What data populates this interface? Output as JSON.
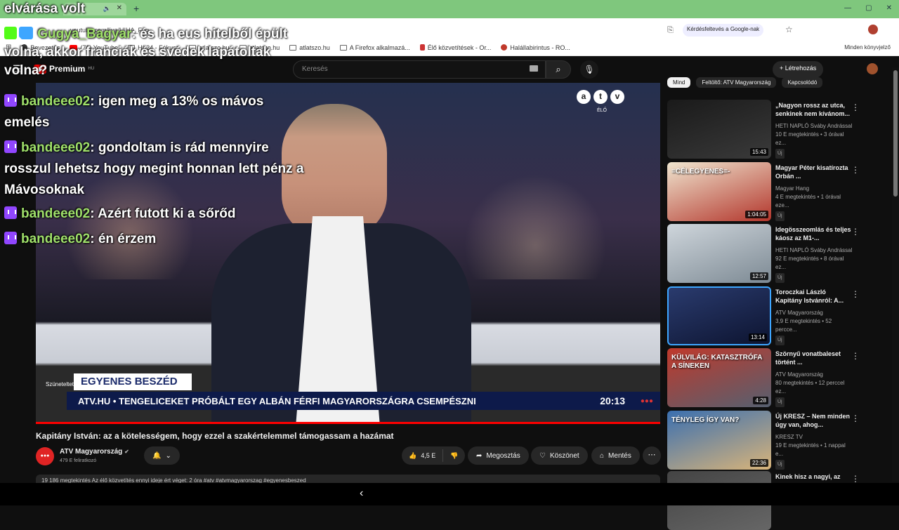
{
  "browser": {
    "tab_title": "elvárása volt",
    "tab_sub": "ss k",
    "url": "youtube.com/live/UIHA_Fgg",
    "search_google": "Kérdésfeltevés a Google-nak",
    "other_bookmarks": "Minden könyvjelző",
    "bookmarks": [
      {
        "label": "Bevezetés",
        "icon": "firefox-icon"
      },
      {
        "label": "(71) YouTube",
        "icon": "youtube-icon"
      },
      {
        "label": "Hír24 - Fókusz",
        "icon": "folder-icon"
      },
      {
        "label": "atlatszo.hu",
        "icon": "folder-icon"
      },
      {
        "label": "atlatszo.hu",
        "icon": "folder-icon"
      },
      {
        "label": "atlatszo.hu",
        "icon": "folder-icon"
      },
      {
        "label": "A Firefox alkalmazá...",
        "icon": "folder-icon"
      },
      {
        "label": "Élő közvetítések - Or...",
        "icon": "live-icon"
      },
      {
        "label": "Halállabirintus - RO...",
        "icon": "game-icon"
      }
    ]
  },
  "youtube": {
    "logo": "Premium",
    "logo_region": "HU",
    "search_placeholder": "Keresés",
    "signin_label": "Létrehozás"
  },
  "chat": {
    "top_line": "elvárása volt",
    "messages": [
      {
        "user": "Gugya_Bagyar",
        "text": ": és ha eus hitelből épült volna, akkor franciák és svédek lapátoltak volna?"
      },
      {
        "user": "bandeee02",
        "text": ": igen meg a 13% os mávos emelés"
      },
      {
        "user": "bandeee02",
        "text": ": gondoltam is rád mennyire rosszul lehetsz hogy megint honnan lett pénz a Mávosoknak"
      },
      {
        "user": "bandeee02",
        "text": ": Azért futott ki a sőrőd"
      },
      {
        "user": "bandeee02",
        "text": ": én érzem"
      }
    ]
  },
  "video": {
    "channel_logo": "atv",
    "live_label": "ÉLŐ",
    "show_name": "EGYENES BESZÉD",
    "site": "ATV.HU",
    "ticker": "• TENGELICEKET PRÓBÁLT EGY ALBÁN FÉRFI MAGYARORSZÁGRA CSEMPÉSZNI",
    "clock": "20:13",
    "small_label": "Szünetelteté... K"
  },
  "info": {
    "title": "Kapitány István: az a kötelességem, hogy ezzel a szakértelemmel támogassam a hazámat",
    "channel": "ATV Magyarország",
    "subs": "479 E feliratkozó",
    "likes": "4,5 E",
    "share": "Megosztás",
    "thanks": "Köszönet",
    "save": "Mentés",
    "desc": "19 186 megtekintés  Az élő közvetítés ennyi ideje ért véget: 2 óra  #atv #atvmagyarorszag #egyenesbeszed"
  },
  "sidebar": {
    "chips": [
      "Mind",
      "Feltöltő: ATV Magyarország",
      "Kapcsolódó"
    ],
    "videos": [
      {
        "title": "„Nagyon rossz az utca, senkinek nem kívánom...",
        "channel": "HETI NAPLÓ Sváby Andrással",
        "meta": "10 E megtekintés • 3 órával ez...",
        "dur": "15:43",
        "badge": "Új",
        "colors": [
          "#1a1a1a",
          "#3a3a3a"
        ]
      },
      {
        "title": "Magyar Péter kisatírozta Orbán ...",
        "channel": "Magyar Hang",
        "meta": "4 E megtekintés • 1 órával eze...",
        "dur": "1:04:05",
        "badge": "Új",
        "colors": [
          "#f0e6d0",
          "#b3362c"
        ]
      },
      {
        "title": "Idegösszeomlás és teljes káosz az M1-...",
        "channel": "HETI NAPLÓ Sváby Andrással",
        "meta": "92 E megtekintés • 8 órával ez...",
        "dur": "12:57",
        "badge": "Új",
        "colors": [
          "#cfd6dc",
          "#7d8a94"
        ]
      },
      {
        "title": "Toroczkai László Kapitány Istvánról: A...",
        "channel": "ATV Magyarország",
        "meta": "3,9 E megtekintés • 52 percce...",
        "dur": "13:14",
        "badge": "Új",
        "colors": [
          "#2a3b6e",
          "#0d1430"
        ]
      },
      {
        "title": "Szörnyű vonatbaleset történt ...",
        "channel": "ATV Magyarország",
        "meta": "80 megtekintés • 12 perccel ez...",
        "dur": "4:28",
        "badge": "Új",
        "colors": [
          "#c0392b",
          "#556070"
        ]
      },
      {
        "title": "Új KRESZ – Nem minden úgy van, ahog...",
        "channel": "KRESZ TV",
        "meta": "19 E megtekintés • 1 nappal e...",
        "dur": "22:36",
        "badge": "Új",
        "colors": [
          "#3a6fb0",
          "#d8b47a"
        ]
      },
      {
        "title": "Kinek hisz a nagyi, az",
        "channel": "",
        "meta": "",
        "dur": "",
        "badge": "",
        "colors": [
          "#444",
          "#666"
        ]
      }
    ],
    "thumb_texts": [
      "",
      "=CÉLEGYENES=-",
      "",
      "",
      "KÜLVILÁG: KATASZTRÓFA A SÍNEKEN",
      "TÉNYLEG ÍGY VAN?",
      ""
    ]
  }
}
